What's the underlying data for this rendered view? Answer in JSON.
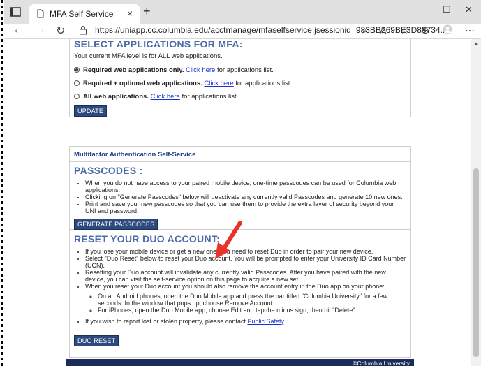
{
  "browser": {
    "tab_title": "MFA Self Service",
    "url": "https://uniapp.cc.columbia.edu/acctmanage/mfaselfservice;jsessionid=983BB269BE3D88734...",
    "new_tab": "+",
    "tab_close": "×",
    "minimize": "—",
    "maximize": "☐",
    "close": "✕"
  },
  "select_apps": {
    "heading": "SELECT APPLICATIONS FOR MFA:",
    "current_level": "Your current MFA level is for ALL web applications.",
    "options": [
      {
        "bold": "Required web applications only.",
        "link": "Click here",
        "rest": " for applications list.",
        "selected": true
      },
      {
        "bold": "Required + optional web applications.",
        "link": "Click here",
        "rest": " for applications list.",
        "selected": false
      },
      {
        "bold": "All web applications.",
        "link": "Click here",
        "rest": " for applications list.",
        "selected": false
      }
    ],
    "update_button": "UPDATE"
  },
  "passcodes": {
    "section_title": "Multifactor Authentication Self-Service",
    "heading": "PASSCODES :",
    "bullets": [
      "When you do not have access to your paired mobile device, one-time passcodes can be used for Columbia web applications.",
      "Clicking on \"Generate Passcodes\" below will deactivate any currently valid Passcodes and generate 10 new ones.",
      "Print and save your new passcodes so that you can use them to provide the extra layer of security beyond your UNI and password."
    ],
    "generate_button": "GENERATE PASSCODES"
  },
  "reset": {
    "heading": "RESET YOUR DUO ACCOUNT:",
    "bullets": [
      "If you lose your mobile device or get a new one, you need to reset Duo in order to pair your new device.",
      "Select \"Duo Reset\" below to reset your Duo account. You will be prompted to enter your University ID Card Number (UCN).",
      "Resetting your Duo account will invalidate any currently valid Passcodes. After you have paired with the new device, you can visit the self-service option on this page to acquire a new set.",
      "When you reset your Duo account you should also remove the account entry in the Duo app on your phone:"
    ],
    "sub_bullets": [
      "On an Android phones, open the Duo Mobile app and press the bar titled \"Columbia University\" for a few seconds. In the window that pops up, choose Remove Account.",
      "For iPhones, open the Duo Mobile app, choose Edit and tap the minus sign, then hit \"Delete\"."
    ],
    "report_text": "If you wish to report lost or stolen property, please contact ",
    "report_link": "Public Safety",
    "report_end": ".",
    "duo_reset_button": "DUO RESET"
  },
  "footer": {
    "copyright": "©Columbia University"
  },
  "colors": {
    "heading_blue": "#4a6aa8",
    "button_navy": "#2c4a7e",
    "footer_navy": "#1b2c5a",
    "arrow_red": "#e8332a"
  }
}
